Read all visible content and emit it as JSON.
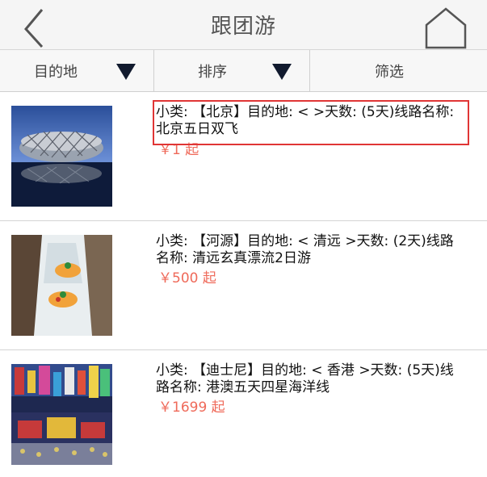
{
  "header": {
    "title": "跟团游"
  },
  "filters": [
    {
      "label": "目的地",
      "has_arrow": true
    },
    {
      "label": "排序",
      "has_arrow": true
    },
    {
      "label": "筛选",
      "has_arrow": false
    }
  ],
  "items": [
    {
      "description": "小类: 【北京】目的地: < >天数: (5天)线路名称: 北京五日双飞",
      "price": "￥1 起",
      "image": "beijing-birds-nest-photo"
    },
    {
      "description": "小类: 【河源】目的地: < 清远 >天数: (2天)线路名称: 清远玄真漂流2日游",
      "price": "￥500 起",
      "image": "river-rafting-photo"
    },
    {
      "description": "小类: 【迪士尼】目的地: < 香港 >天数: (5天)线路名称: 港澳五天四星海洋线",
      "price": "￥1699 起",
      "image": "hong-kong-street-photo"
    }
  ],
  "colors": {
    "price": "#ef6a5a",
    "highlight_border": "#e03535",
    "arrow": "#111a2e"
  },
  "icons": [
    "back-chevron-icon",
    "home-icon",
    "dropdown-triangle-icon"
  ]
}
